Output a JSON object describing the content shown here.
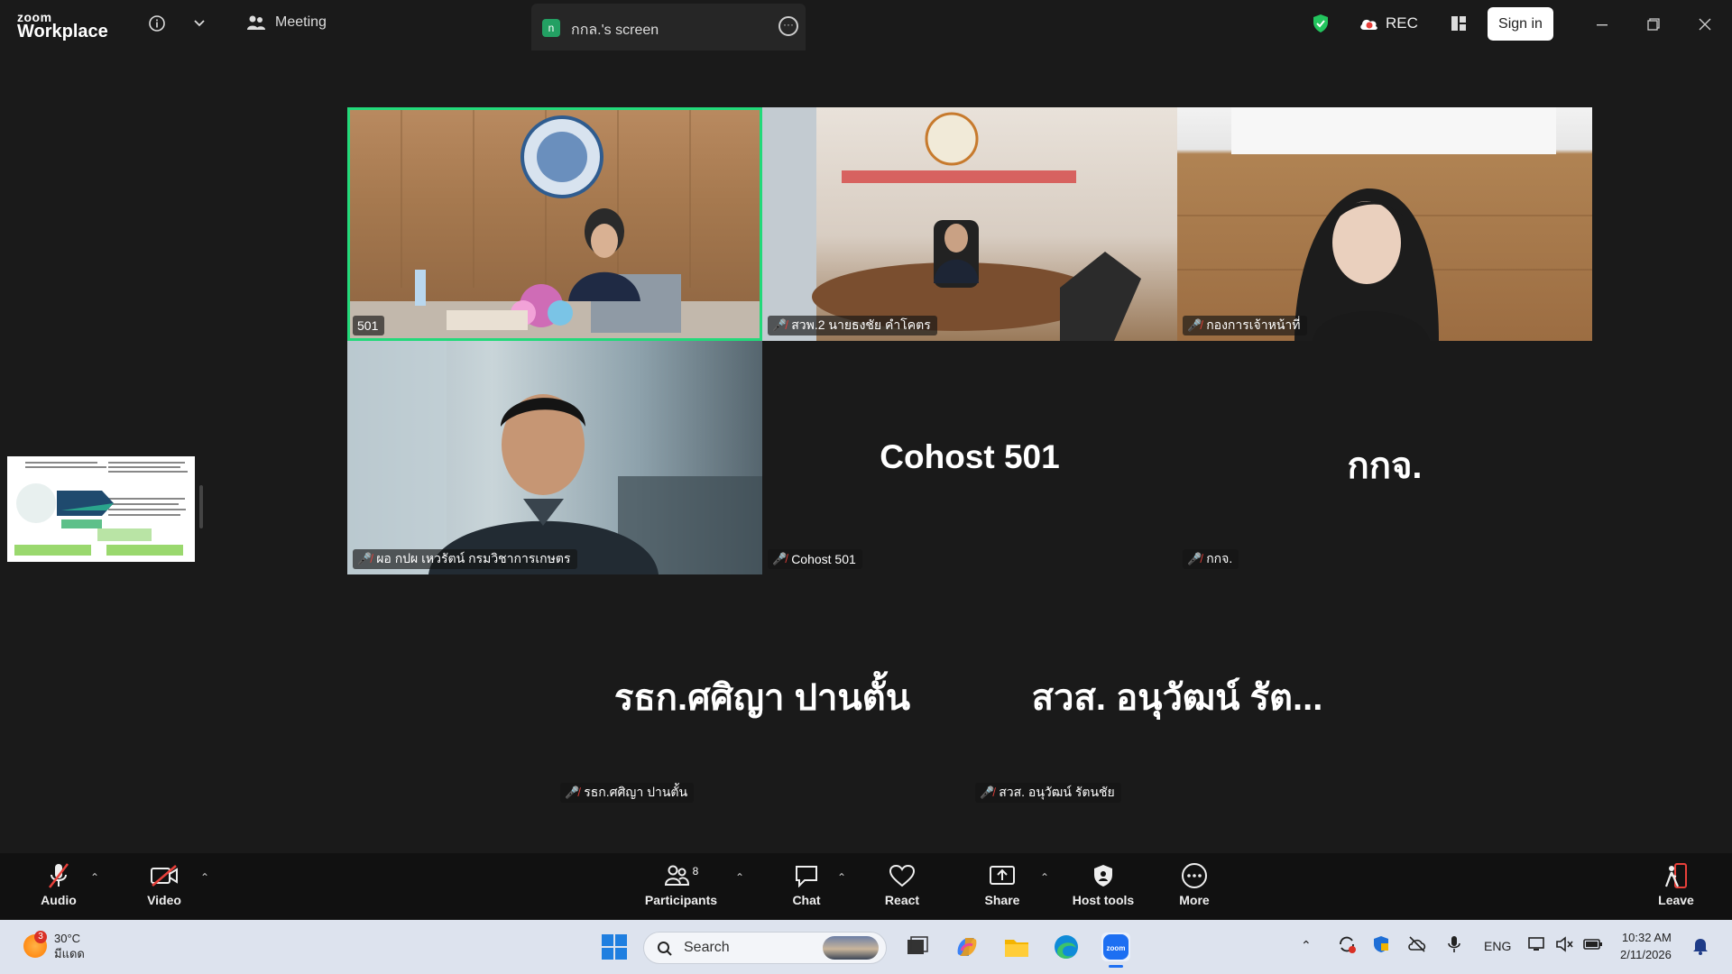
{
  "topbar": {
    "logo_top": "zoom",
    "logo_bottom": "Workplace",
    "meeting_label": "Meeting",
    "share_tab_badge": "n",
    "share_tab_title": "กกล.'s screen",
    "rec_label": "REC",
    "signin_label": "Sign in"
  },
  "tiles": [
    {
      "label": "501",
      "muted": false
    },
    {
      "label": "สวพ.2 นายธงชัย คำโคตร",
      "muted": true
    },
    {
      "label": "กองการเจ้าหน้าที่",
      "muted": true
    },
    {
      "label": "ผอ กปผ เหวรัตน์ กรมวิชาการเกษตร",
      "muted": true
    },
    {
      "label": "Cohost 501",
      "muted": true,
      "center": "Cohost 501"
    },
    {
      "label": "กกจ.",
      "muted": true,
      "center": "กกจ."
    },
    {
      "label": "รธก.ศศิญา ปานตั้น",
      "muted": true,
      "center": "รธก.ศศิญา ปานตั้น"
    },
    {
      "label": "สวส. อนุวัฒน์ รัตนชัย",
      "muted": true,
      "center": "สวส. อนุวัฒน์ รัต..."
    }
  ],
  "toolbar": {
    "audio": "Audio",
    "video": "Video",
    "participants": "Participants",
    "participants_count": "8",
    "chat": "Chat",
    "react": "React",
    "share": "Share",
    "host_tools": "Host tools",
    "more": "More",
    "leave": "Leave"
  },
  "taskbar": {
    "weather_badge": "3",
    "temperature": "30°C",
    "weather_text": "มีแดด",
    "search_placeholder": "Search",
    "lang": "ENG",
    "time": "10:32 AM",
    "date": "2/11/2026"
  },
  "colors": {
    "active_speaker": "#23d97a",
    "muted_icon": "#e8403a",
    "leave": "#e8403a"
  }
}
